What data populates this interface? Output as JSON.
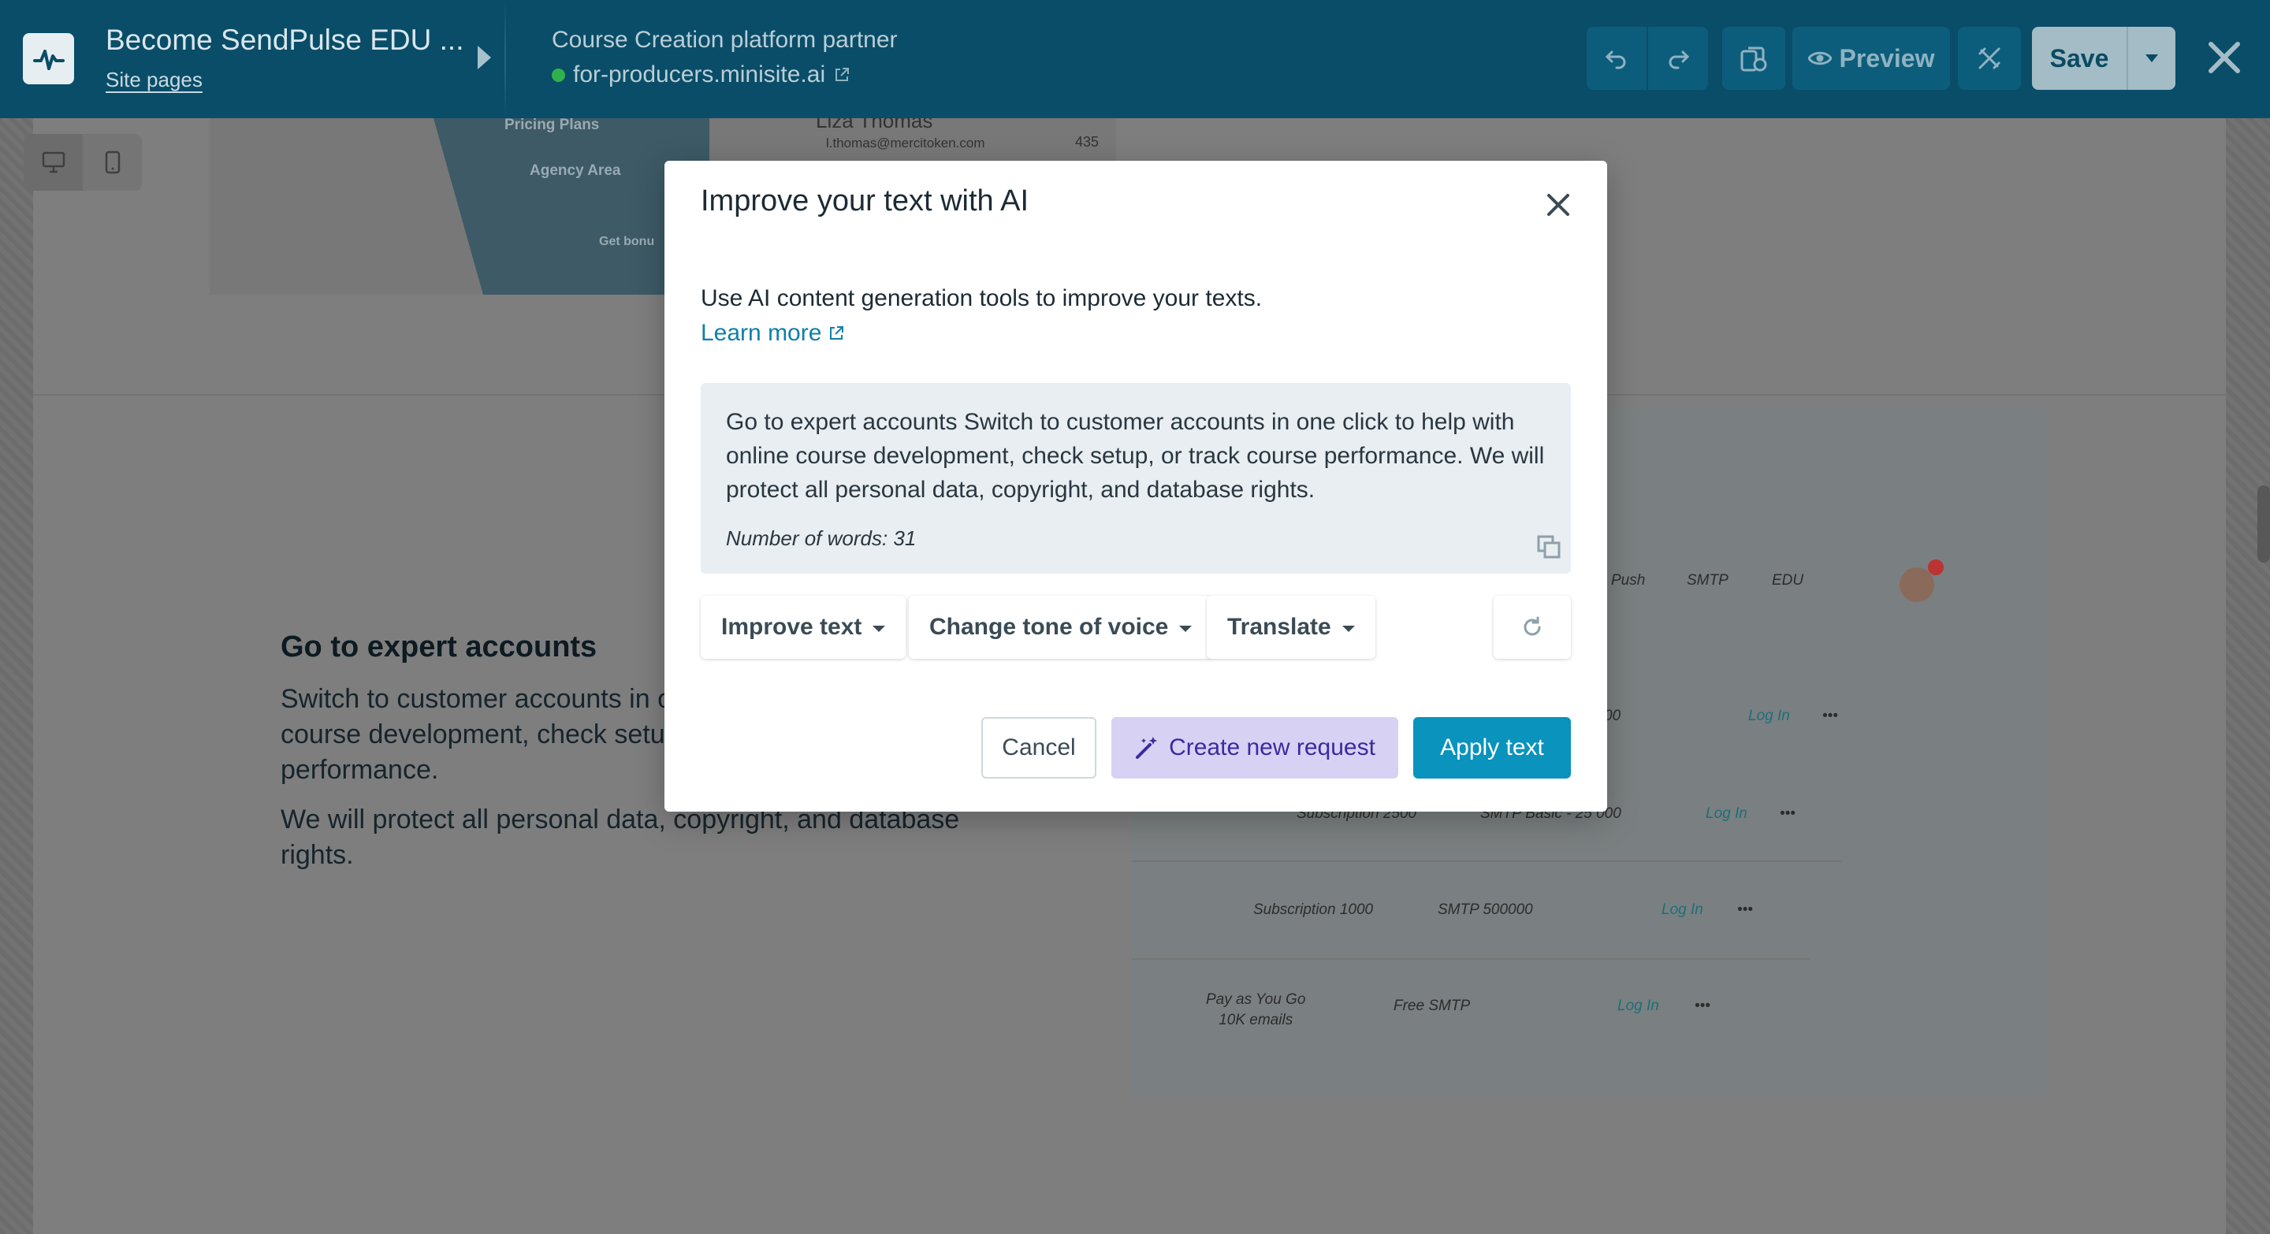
{
  "topbar": {
    "site_title": "Become SendPulse EDU ...",
    "site_pages_link": "Site pages",
    "partner_label": "Course Creation platform partner",
    "domain": "for-producers.minisite.ai",
    "preview_label": "Preview",
    "save_label": "Save",
    "icons": {
      "logo": "pulse-logo-icon",
      "undo": "undo-icon",
      "redo": "redo-icon",
      "history": "history-icon",
      "preview": "eye-icon",
      "settings": "tools-icon",
      "close": "close-icon"
    }
  },
  "canvas": {
    "device_toggle": [
      "desktop-icon",
      "mobile-icon"
    ],
    "sidebar_items": [
      "Pricing Plans",
      "Agency Area",
      "Get bonu"
    ],
    "user_name": "Liza Thomas",
    "user_email": "l.thomas@mercitoken.com",
    "user_number": "435",
    "section_heading": "Go to expert accounts",
    "section_paragraph_1": "Switch to customer accounts in one click to help with online course development, check setup, or track course performance.",
    "section_paragraph_2": "We will protect all personal data, copyright, and database rights.",
    "dashboard": {
      "nav": [
        "Push",
        "SMTP",
        "EDU"
      ],
      "rows": [
        {
          "plan": "",
          "smtp": "00",
          "action": "Log In"
        },
        {
          "plan": "Subscription 2500",
          "smtp": "SMTP Basic - 25 000",
          "action": "Log In"
        },
        {
          "plan": "Subscription 1000",
          "smtp": "SMTP 500000",
          "action": "Log In"
        },
        {
          "plan": "Pay as You Go\n10K emails",
          "smtp": "Free SMTP",
          "action": "Log In"
        }
      ],
      "more": "•••",
      "badge": "1"
    }
  },
  "modal": {
    "title": "Improve your text with AI",
    "description": "Use AI content generation tools to improve your texts.",
    "learn_more": "Learn more",
    "source_text": "Go to expert accounts Switch to customer accounts in one click to help with online course development, check setup, or track course performance. We will protect all personal data, copyright, and database rights.",
    "word_count": "Number of words: 31",
    "options": {
      "improve": "Improve text",
      "tone": "Change tone of voice",
      "translate": "Translate"
    },
    "buttons": {
      "cancel": "Cancel",
      "create": "Create new request",
      "apply": "Apply text"
    },
    "colors": {
      "primary": "#0a93bd",
      "ai_accent": "#d7d1f3",
      "topbar": "#0a4d68"
    }
  }
}
